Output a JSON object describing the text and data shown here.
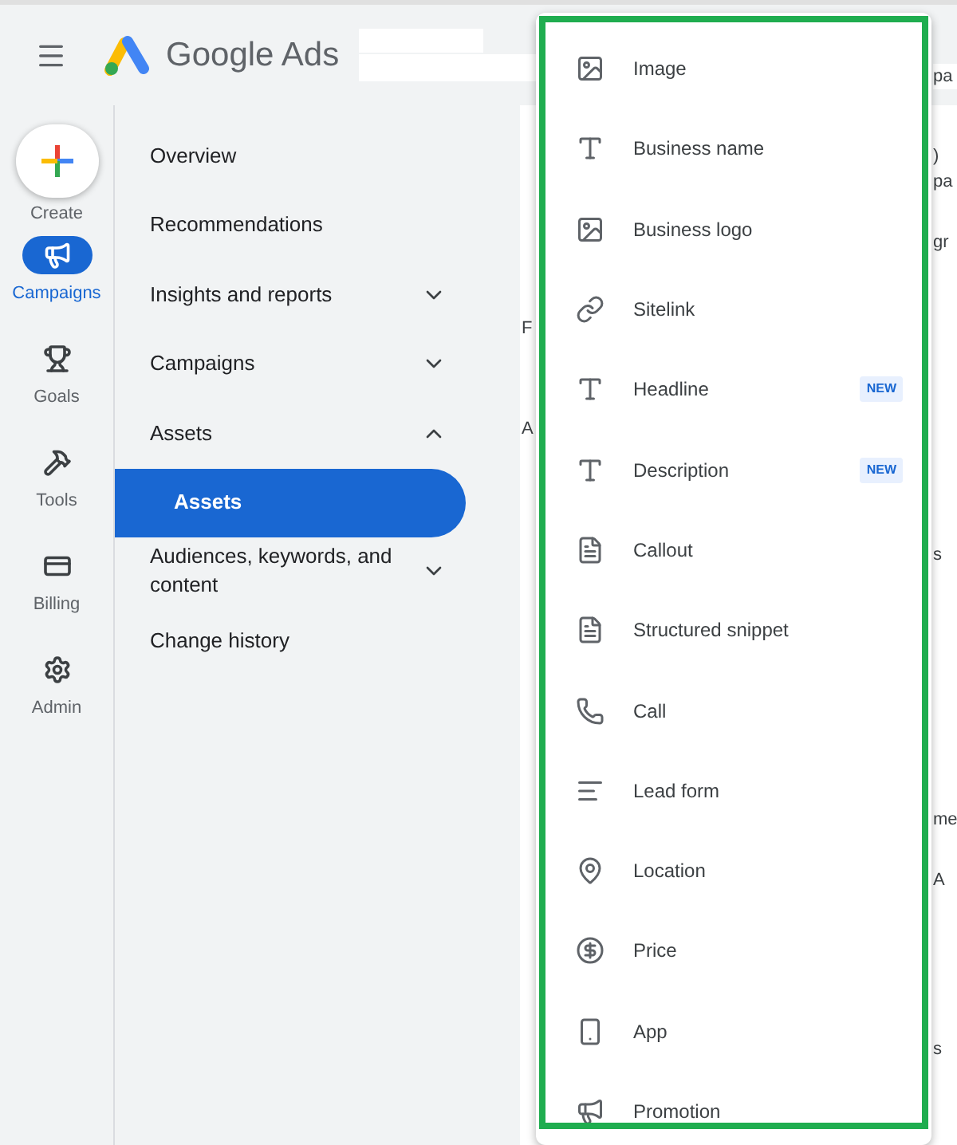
{
  "header": {
    "logo_text": "Google Ads"
  },
  "rail": [
    {
      "label": "Create",
      "kind": "create",
      "selected": false
    },
    {
      "label": "Campaigns",
      "kind": "nav",
      "selected": true
    },
    {
      "label": "Goals",
      "kind": "nav",
      "selected": false
    },
    {
      "label": "Tools",
      "kind": "nav",
      "selected": false
    },
    {
      "label": "Billing",
      "kind": "nav",
      "selected": false
    },
    {
      "label": "Admin",
      "kind": "nav",
      "selected": false
    }
  ],
  "nav": [
    {
      "label": "Overview",
      "kind": "link"
    },
    {
      "label": "Recommendations",
      "kind": "link"
    },
    {
      "label": "Insights and reports",
      "kind": "group",
      "expanded": false
    },
    {
      "label": "Campaigns",
      "kind": "group",
      "expanded": false
    },
    {
      "label": "Assets",
      "kind": "group",
      "expanded": true,
      "children": [
        {
          "label": "Assets",
          "selected": true
        }
      ]
    },
    {
      "label": "Audiences, keywords, and content",
      "kind": "group",
      "expanded": false
    },
    {
      "label": "Change history",
      "kind": "link"
    }
  ],
  "background_fragments_left": [
    "F",
    "A"
  ],
  "background_fragments_right": [
    "pa",
    ")",
    "pa",
    "gr",
    "s",
    "me",
    "A",
    "s"
  ],
  "menu": [
    {
      "label": "Image"
    },
    {
      "label": "Business name"
    },
    {
      "label": "Business logo"
    },
    {
      "label": "Sitelink"
    },
    {
      "label": "Headline",
      "badge": "NEW"
    },
    {
      "label": "Description",
      "badge": "NEW"
    },
    {
      "label": "Callout"
    },
    {
      "label": "Structured snippet"
    },
    {
      "label": "Call"
    },
    {
      "label": "Lead form"
    },
    {
      "label": "Location"
    },
    {
      "label": "Price"
    },
    {
      "label": "App"
    },
    {
      "label": "Promotion"
    }
  ]
}
